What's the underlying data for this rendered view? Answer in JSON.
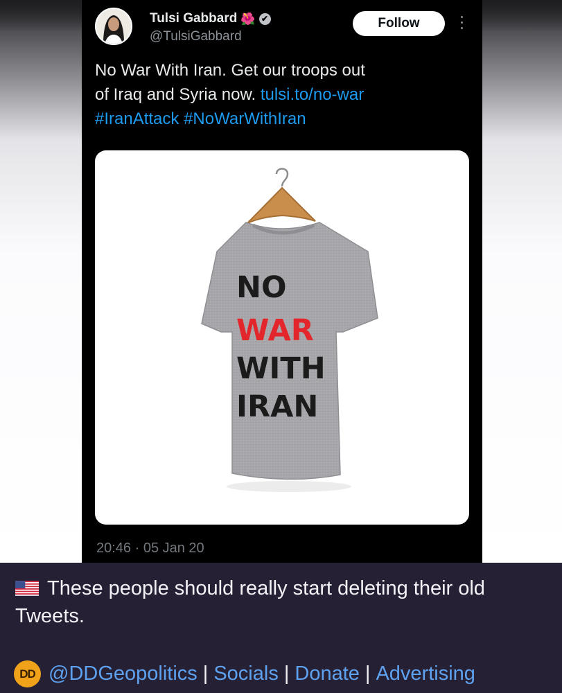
{
  "tweet": {
    "display_name": "Tulsi Gabbard",
    "name_emoji": "🌺",
    "verified_mark": "✔",
    "handle": "@TulsiGabbard",
    "follow_label": "Follow",
    "text_line1": "No War With Iran. Get our troops out",
    "text_line2_plain": "of Iraq and Syria now. ",
    "link": "tulsi.to/no-war",
    "hashtag1": "#IranAttack",
    "hashtag2": "#NoWarWithIran",
    "timestamp": "20:46 · 05 Jan 20",
    "shirt_text": {
      "line1": "NO",
      "line2": "WAR",
      "line3": "WITH",
      "line4": "IRAN"
    },
    "icons": {
      "verified": "verified-badge-icon",
      "more": "more-options-icon"
    }
  },
  "post": {
    "flag": "🇺🇸",
    "caption": "These people should really start deleting their old Tweets.",
    "logo_text": "DD",
    "footer_handle": "@DDGeopolitics",
    "footer_separator": "|",
    "footer_socials": "Socials",
    "footer_donate": "Donate",
    "footer_advertising": "Advertising"
  },
  "colors": {
    "background": "#262034",
    "tweet_background": "#000000",
    "link": "#1d9bf0",
    "footer_link": "#5ea1ef",
    "logo": "#f0a21b",
    "shirt_red_word": "#e3262b"
  }
}
